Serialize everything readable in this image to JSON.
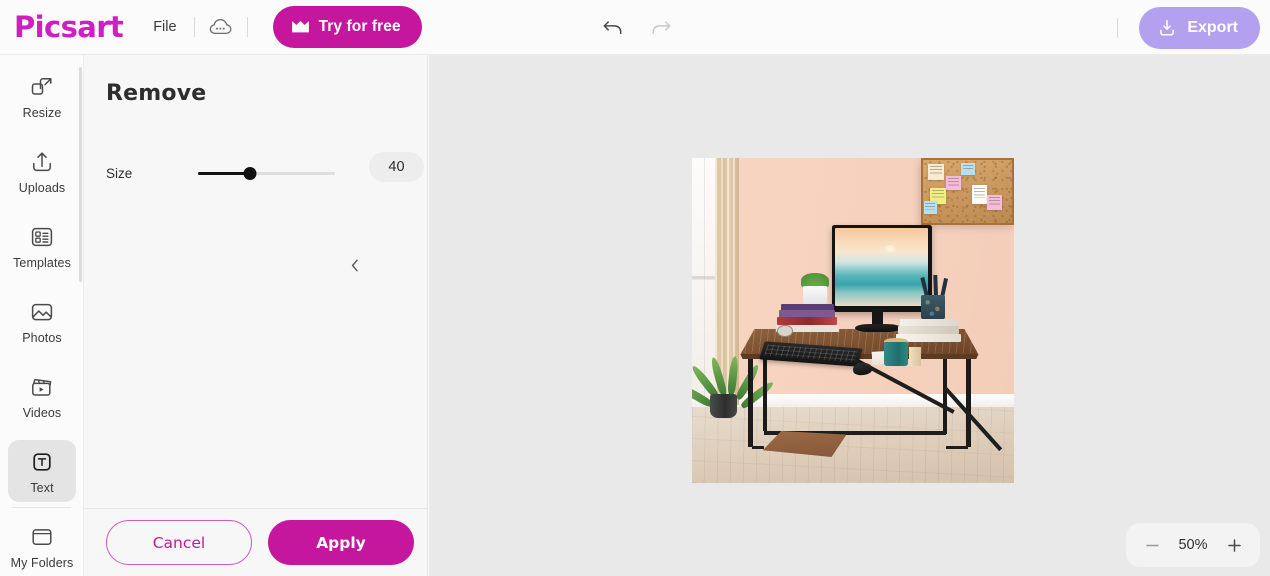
{
  "header": {
    "logo_text": "Picsart",
    "file_label": "File",
    "cloud_icon": "cloud-dots-icon",
    "try_label": "Try for free",
    "crown_icon": "crown-icon",
    "undo_icon": "undo-arrow-icon",
    "redo_icon": "redo-arrow-icon",
    "export_label": "Export",
    "export_icon": "download-icon"
  },
  "sidebar": {
    "items": [
      {
        "label": "Resize",
        "icon": "resize-icon",
        "active": false
      },
      {
        "label": "Uploads",
        "icon": "upload-icon",
        "active": false
      },
      {
        "label": "Templates",
        "icon": "templates-icon",
        "active": false
      },
      {
        "label": "Photos",
        "icon": "photo-icon",
        "active": false
      },
      {
        "label": "Videos",
        "icon": "video-icon",
        "active": false
      },
      {
        "label": "Text",
        "icon": "text-icon",
        "active": true
      }
    ],
    "bottom": {
      "label": "My Folders",
      "icon": "folder-icon"
    }
  },
  "panel": {
    "title": "Remove",
    "size": {
      "label": "Size",
      "value": "40",
      "percent": 38,
      "min": "0",
      "max": "100"
    },
    "cancel_label": "Cancel",
    "apply_label": "Apply",
    "collapse_icon": "chevron-left-icon"
  },
  "canvas": {
    "zoom": {
      "minus_icon": "minus-icon",
      "value": "50%",
      "plus_icon": "plus-icon"
    },
    "artboard_alt": "office-desk-photo"
  },
  "colors": {
    "brand_magenta": "#c4179e",
    "export_lavender": "#b3a0ee",
    "panel_bg": "#f7f7f7",
    "canvas_bg": "#e9e9e9",
    "header_bg": "#fbfbfb",
    "active_item": "#e4e4e4"
  }
}
